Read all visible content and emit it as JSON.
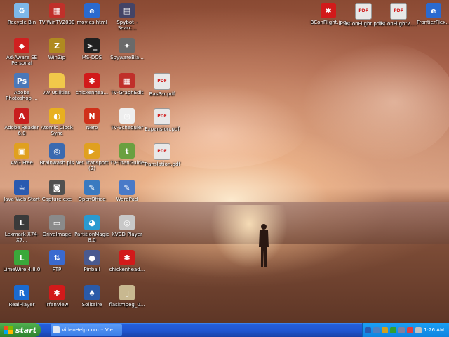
{
  "desktop": {
    "icons": [
      {
        "label": "Recycle Bin",
        "icon": "recycle-bin-icon",
        "color": "#7db7e8",
        "glyph": "♻"
      },
      {
        "label": "TV-WinTV2000",
        "icon": "tv-icon",
        "color": "#c0302a",
        "glyph": "▦"
      },
      {
        "label": "movies.html",
        "icon": "html-file-icon",
        "color": "#2a6ad0",
        "glyph": "e"
      },
      {
        "label": "Spybot - Searc...",
        "icon": "spybot-icon",
        "color": "#444466",
        "glyph": "▤"
      },
      {
        "label": "Ad-Aware SE Personal",
        "icon": "ad-aware-icon",
        "color": "#d02020",
        "glyph": "◆"
      },
      {
        "label": "WinZip",
        "icon": "winzip-icon",
        "color": "#b08a20",
        "glyph": "Z"
      },
      {
        "label": "MS-DOS",
        "icon": "dos-icon",
        "color": "#202020",
        "glyph": ">_"
      },
      {
        "label": "SpywareBla...",
        "icon": "spywareblaster-icon",
        "color": "#6a6a6a",
        "glyph": "✦"
      },
      {
        "label": "Adobe Photoshop ...",
        "icon": "photoshop-icon",
        "color": "#4a78b8",
        "glyph": "Ps"
      },
      {
        "label": "AV Utilities",
        "icon": "folder-icon",
        "color": "#f1c84a",
        "glyph": ""
      },
      {
        "label": "chickenhea...",
        "icon": "chicken-icon",
        "color": "#d21a1a",
        "glyph": "✱"
      },
      {
        "label": "TV-GraphEdit",
        "icon": "graphedit-icon",
        "color": "#c0302a",
        "glyph": "▦"
      },
      {
        "label": "BasPar.pdf",
        "icon": "pdf-icon",
        "color": "#e8e8e8",
        "glyph": "PDF"
      },
      {
        "label": "Adobe Reader 6.0",
        "icon": "adobe-reader-icon",
        "color": "#c81e1e",
        "glyph": "A"
      },
      {
        "label": "Atomic Clock Sync",
        "icon": "clock-sync-icon",
        "color": "#e8b020",
        "glyph": "◐"
      },
      {
        "label": "Nero",
        "icon": "nero-icon",
        "color": "#d0301a",
        "glyph": "N"
      },
      {
        "label": "TV-Scheduler",
        "icon": "scheduler-icon",
        "color": "#eeeeee",
        "glyph": "◷"
      },
      {
        "label": "Expansion.pdf",
        "icon": "pdf-icon",
        "color": "#e8e8e8",
        "glyph": "PDF"
      },
      {
        "label": "AVG Free",
        "icon": "avg-icon",
        "color": "#e0a020",
        "glyph": "▣"
      },
      {
        "label": "Brainwash.pls",
        "icon": "playlist-icon",
        "color": "#3a6ab0",
        "glyph": "◎"
      },
      {
        "label": "Net Transport (2)",
        "icon": "net-transport-icon",
        "color": "#e0a020",
        "glyph": "▶"
      },
      {
        "label": "TV-TitanGuide",
        "icon": "titan-icon",
        "color": "#6aa040",
        "glyph": "t"
      },
      {
        "label": "Translation.pdf",
        "icon": "pdf-icon",
        "color": "#e8e8e8",
        "glyph": "PDF"
      },
      {
        "label": "Java Web Start",
        "icon": "java-icon",
        "color": "#2a5ab0",
        "glyph": "☕"
      },
      {
        "label": "Capture.exe",
        "icon": "camera-icon",
        "color": "#505050",
        "glyph": "◙"
      },
      {
        "label": "OpenOffice",
        "icon": "openoffice-icon",
        "color": "#3a7ac0",
        "glyph": "✎"
      },
      {
        "label": "WordPad",
        "icon": "wordpad-icon",
        "color": "#4a7ac8",
        "glyph": "✎"
      },
      {
        "label": "Lexmark X74-X7...",
        "icon": "printer-icon",
        "color": "#3a3a3a",
        "glyph": "L"
      },
      {
        "label": "DriveImage",
        "icon": "driveimage-icon",
        "color": "#8a8a8a",
        "glyph": "▭"
      },
      {
        "label": "PartitionMagic 8.0",
        "icon": "partitionmagic-icon",
        "color": "#2a9ad0",
        "glyph": "◕"
      },
      {
        "label": "XVCD Player",
        "icon": "xvcd-icon",
        "color": "#c8c8c8",
        "glyph": "◎"
      },
      {
        "label": "LimeWire 4.8.0",
        "icon": "limewire-icon",
        "color": "#3aa83a",
        "glyph": "L"
      },
      {
        "label": "FTP",
        "icon": "ftp-icon",
        "color": "#3a6ad0",
        "glyph": "⇅"
      },
      {
        "label": "Pinball",
        "icon": "pinball-icon",
        "color": "#4a5a90",
        "glyph": "●"
      },
      {
        "label": "chickenhead...",
        "icon": "chicken-icon",
        "color": "#d21a1a",
        "glyph": "✱"
      },
      {
        "label": "RealPlayer",
        "icon": "realplayer-icon",
        "color": "#1a6ad0",
        "glyph": "R"
      },
      {
        "label": "IrfanView",
        "icon": "irfanview-icon",
        "color": "#d21a1a",
        "glyph": "✱"
      },
      {
        "label": "Solitaire",
        "icon": "solitaire-icon",
        "color": "#2a5aa8",
        "glyph": "♠"
      },
      {
        "label": "flaskmpeg_0...",
        "icon": "flask-icon",
        "color": "#c8b890",
        "glyph": "▯"
      },
      {
        "label": "BConFlight.jpg",
        "icon": "image-file-icon",
        "color": "#d21a1a",
        "glyph": "✱"
      },
      {
        "label": "BConFlight.pdf",
        "icon": "pdf-icon",
        "color": "#e8e8e8",
        "glyph": "PDF"
      },
      {
        "label": "BConFlight2....",
        "icon": "pdf-icon",
        "color": "#e8e8e8",
        "glyph": "PDF"
      },
      {
        "label": "FrontierFlex...",
        "icon": "html-file-icon",
        "color": "#2a6ad0",
        "glyph": "e"
      }
    ]
  },
  "taskbar": {
    "start_label": "start",
    "task_label": "VideoHelp.com :: Vie...",
    "clock": "1:26 AM",
    "tray_colors": [
      "#2a5ab0",
      "#5080c0",
      "#d0a020",
      "#30a030",
      "#8080a0",
      "#e04040",
      "#c0c0c0"
    ]
  }
}
